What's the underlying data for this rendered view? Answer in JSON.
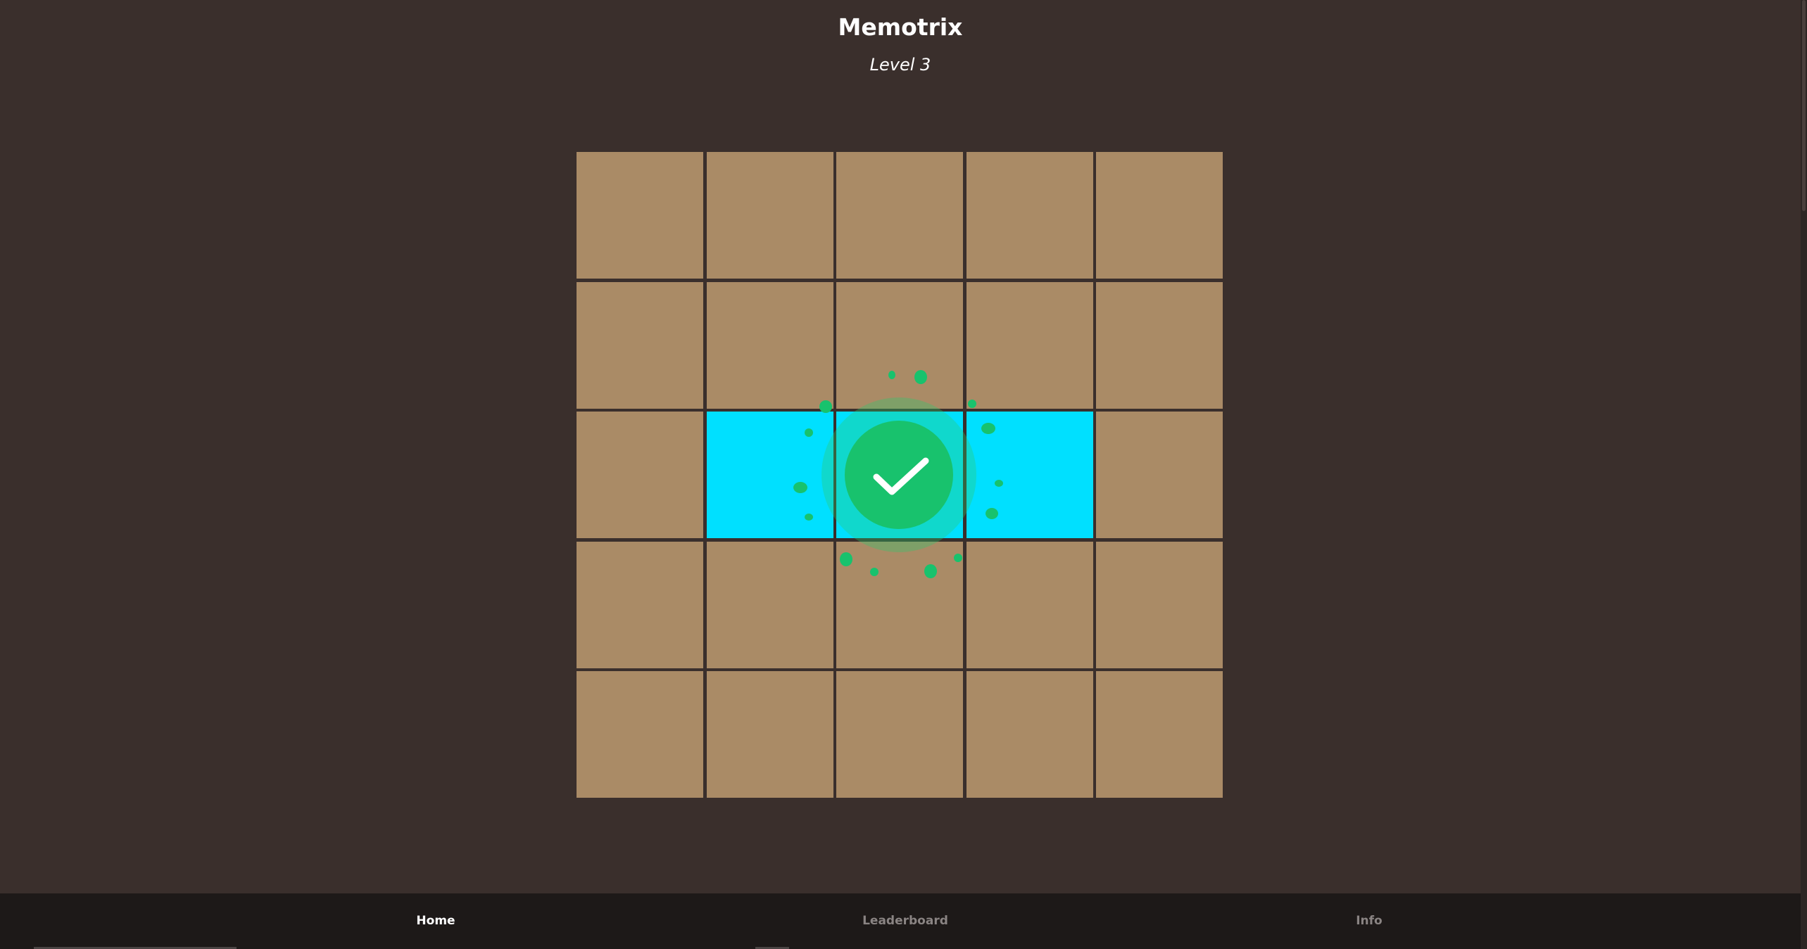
{
  "header": {
    "title": "Memotrix",
    "level_label": "Level 3"
  },
  "game": {
    "grid_rows": 5,
    "grid_cols": 5,
    "active_cells": [
      [
        2,
        1
      ],
      [
        2,
        2
      ],
      [
        2,
        3
      ]
    ],
    "status": "success",
    "colors": {
      "background": "#3a2f2c",
      "cell": "#aa8b66",
      "cell_active": "#00e0ff",
      "success": "#18c26d"
    }
  },
  "nav": {
    "items": [
      {
        "label": "Home",
        "active": true
      },
      {
        "label": "Leaderboard",
        "active": false
      },
      {
        "label": "Info",
        "active": false
      }
    ]
  },
  "icons": {
    "success": "checkmark-icon"
  }
}
